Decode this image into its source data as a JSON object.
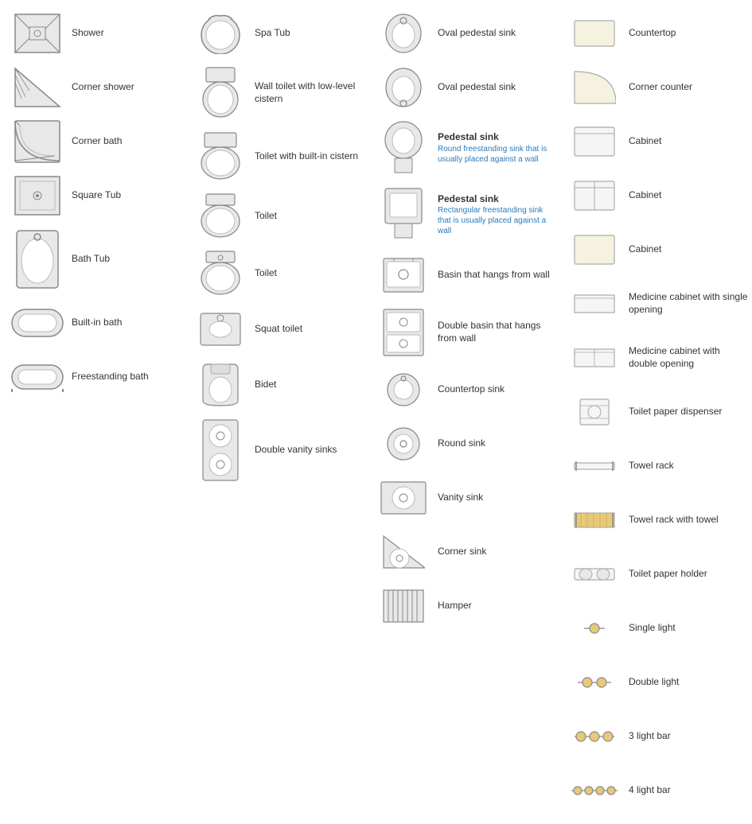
{
  "col1": [
    {
      "id": "shower",
      "label": "Shower",
      "sub": ""
    },
    {
      "id": "corner-shower",
      "label": "Corner shower",
      "sub": ""
    },
    {
      "id": "corner-bath",
      "label": "Corner bath",
      "sub": ""
    },
    {
      "id": "square-tub",
      "label": "Square Tub",
      "sub": ""
    },
    {
      "id": "bath-tub",
      "label": "Bath Tub",
      "sub": ""
    },
    {
      "id": "built-in-bath",
      "label": "Built-in bath",
      "sub": ""
    },
    {
      "id": "freestanding-bath",
      "label": "Freestanding bath",
      "sub": ""
    }
  ],
  "col2": [
    {
      "id": "spa-tub",
      "label": "Spa Tub",
      "sub": ""
    },
    {
      "id": "wall-toilet",
      "label": "Wall toilet with low-level cistern",
      "sub": ""
    },
    {
      "id": "toilet-builtin",
      "label": "Toilet with built-in cistern",
      "sub": ""
    },
    {
      "id": "toilet",
      "label": "Toilet",
      "sub": ""
    },
    {
      "id": "toilet2",
      "label": "Toilet",
      "sub": ""
    },
    {
      "id": "squat-toilet",
      "label": "Squat toilet",
      "sub": ""
    },
    {
      "id": "bidet",
      "label": "Bidet",
      "sub": ""
    },
    {
      "id": "double-vanity",
      "label": "Double vanity sinks",
      "sub": ""
    }
  ],
  "col3": [
    {
      "id": "oval-pedestal1",
      "label": "Oval pedestal sink",
      "sub": ""
    },
    {
      "id": "oval-pedestal2",
      "label": "Oval pedestal sink",
      "sub": ""
    },
    {
      "id": "pedestal-round",
      "label": "Pedestal sink",
      "sub": "Round freestanding sink that is usually placed against a wall"
    },
    {
      "id": "pedestal-rect",
      "label": "Pedestal sink",
      "sub": "Rectangular freestanding sink that is usually placed against a wall"
    },
    {
      "id": "basin-wall",
      "label": "Basin that hangs from wall",
      "sub": ""
    },
    {
      "id": "double-basin",
      "label": "Double basin that hangs from wall",
      "sub": ""
    },
    {
      "id": "countertop-sink",
      "label": "Countertop sink",
      "sub": ""
    },
    {
      "id": "round-sink",
      "label": "Round sink",
      "sub": ""
    },
    {
      "id": "vanity-sink",
      "label": "Vanity sink",
      "sub": ""
    },
    {
      "id": "corner-sink",
      "label": "Corner sink",
      "sub": ""
    },
    {
      "id": "hamper",
      "label": "Hamper",
      "sub": ""
    }
  ],
  "col4": [
    {
      "id": "countertop",
      "label": "Countertop",
      "sub": ""
    },
    {
      "id": "corner-counter",
      "label": "Corner counter",
      "sub": ""
    },
    {
      "id": "cabinet1",
      "label": "Cabinet",
      "sub": ""
    },
    {
      "id": "cabinet2",
      "label": "Cabinet",
      "sub": ""
    },
    {
      "id": "cabinet3",
      "label": "Cabinet",
      "sub": ""
    },
    {
      "id": "medicine-single",
      "label": "Medicine cabinet with single opening",
      "sub": ""
    },
    {
      "id": "medicine-double",
      "label": "Medicine cabinet with double opening",
      "sub": ""
    },
    {
      "id": "tp-dispenser",
      "label": "Toilet paper dispenser",
      "sub": ""
    },
    {
      "id": "towel-rack",
      "label": "Towel rack",
      "sub": ""
    },
    {
      "id": "towel-rack-towel",
      "label": "Towel rack with towel",
      "sub": ""
    },
    {
      "id": "tp-holder",
      "label": "Toilet paper holder",
      "sub": ""
    },
    {
      "id": "single-light",
      "label": "Single light",
      "sub": ""
    },
    {
      "id": "double-light",
      "label": "Double light",
      "sub": ""
    },
    {
      "id": "3-light",
      "label": "3 light bar",
      "sub": ""
    },
    {
      "id": "4-light",
      "label": "4 light bar",
      "sub": ""
    }
  ]
}
